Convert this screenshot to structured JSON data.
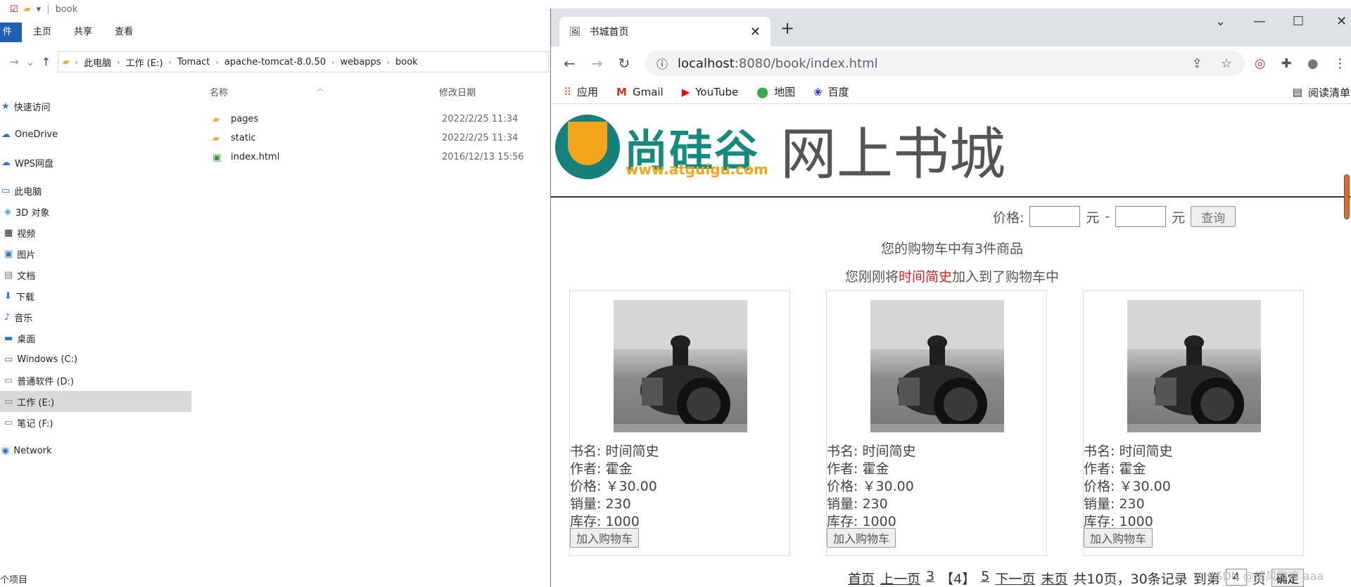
{
  "explorer": {
    "title": "book",
    "ribbon": [
      "件",
      "主页",
      "共享",
      "查看"
    ],
    "path": [
      "此电脑",
      "工作 (E:)",
      "Tomact",
      "apache-tomcat-8.0.50",
      "webapps",
      "book"
    ],
    "tree": [
      "快速访问",
      "OneDrive",
      "WPS网盘",
      "此电脑",
      "3D 对象",
      "视频",
      "图片",
      "文档",
      "下载",
      "音乐",
      "桌面",
      "Windows (C:)",
      "普通软件 (D:)",
      "工作 (E:)",
      "笔记 (F:)",
      "Network"
    ],
    "columns": [
      "名称",
      "修改日期"
    ],
    "files": [
      {
        "name": "pages",
        "date": "2022/2/25 11:34"
      },
      {
        "name": "static",
        "date": "2022/2/25 11:34"
      },
      {
        "name": "index.html",
        "date": "2016/12/13 15:56"
      }
    ],
    "status": "个项目"
  },
  "browser": {
    "tab_title": "书城首页",
    "url_host": "localhost",
    "url_path": ":8080/book/index.html",
    "bookmarks": [
      "应用",
      "Gmail",
      "YouTube",
      "地图",
      "百度"
    ],
    "reading_list": "阅读清单"
  },
  "page": {
    "logo_text": "尚硅谷",
    "logo_url": "www.atguigu.com",
    "site_title": "网上书城",
    "search": {
      "price_label": "价格:",
      "min": "",
      "max": "",
      "unit": "元",
      "dash": "-",
      "button": "查询"
    },
    "cart_count": "您的购物车中有3件商品",
    "cart_msg_prefix": "您刚刚将",
    "cart_msg_book": "时间简史",
    "cart_msg_suffix": "加入到了购物车中",
    "labels": {
      "name": "书名: ",
      "author": "作者: ",
      "price": "价格: ",
      "sales": "销量: ",
      "stock": "库存: "
    },
    "books": [
      {
        "name": "时间简史",
        "author": "霍金",
        "price": "￥30.00",
        "sales": "230",
        "stock": "1000"
      },
      {
        "name": "时间简史",
        "author": "霍金",
        "price": "￥30.00",
        "sales": "230",
        "stock": "1000"
      },
      {
        "name": "时间简史",
        "author": "霍金",
        "price": "￥30.00",
        "sales": "230",
        "stock": "1000"
      }
    ],
    "add_to_cart": "加入购物车",
    "pager": {
      "first": "首页",
      "prev": "上一页",
      "p3": "3",
      "current": "【4】",
      "p5": "5",
      "next": "下一页",
      "last": "末页",
      "summary": "共10页，30条记录",
      "goto": "到第",
      "input": "4",
      "unit": "页",
      "ok": "确定"
    }
  },
  "watermark": "CSDN @请风微凉 aaa",
  "colors": {
    "accent": "#e21d1d",
    "logo_teal": "#178a7f",
    "logo_orange": "#f3a51b",
    "explorer_file_tab": "#1f5fb4"
  }
}
